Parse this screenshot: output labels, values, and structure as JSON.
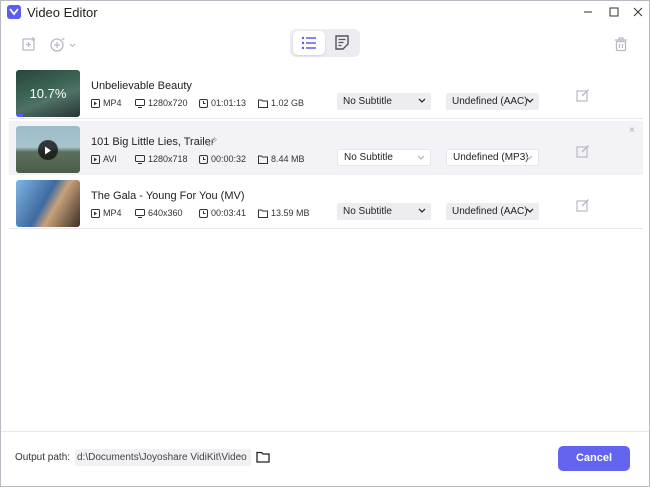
{
  "window": {
    "title": "Video Editor"
  },
  "colors": {
    "accent": "#6264ee"
  },
  "toolbar": {
    "icons": [
      "add-file-icon",
      "add-effect-icon",
      "list-view-icon",
      "subtitle-view-icon",
      "trash-icon"
    ]
  },
  "files": [
    {
      "name": "Unbelievable Beauty",
      "progress_label": "10.7%",
      "progress": 0.107,
      "format": "MP4",
      "resolution": "1280x720",
      "duration": "01:01:13",
      "size": "1.02 GB",
      "subtitle": "No Subtitle",
      "audio": "Undefined (AAC)"
    },
    {
      "name": "101 Big Little Lies, Trailer",
      "format": "AVI",
      "resolution": "1280x718",
      "duration": "00:00:32",
      "size": "8.44 MB",
      "subtitle": "No Subtitle",
      "audio": "Undefined (MP3)",
      "close": "×"
    },
    {
      "name": "The Gala - Young For You (MV)",
      "format": "MP4",
      "resolution": "640x360",
      "duration": "00:03:41",
      "size": "13.59 MB",
      "subtitle": "No Subtitle",
      "audio": "Undefined (AAC)"
    }
  ],
  "footer": {
    "output_label": "Output path:",
    "output_path": "d:\\Documents\\Joyoshare VidiKit\\Video",
    "browse": "···",
    "cancel_label": "Cancel"
  }
}
